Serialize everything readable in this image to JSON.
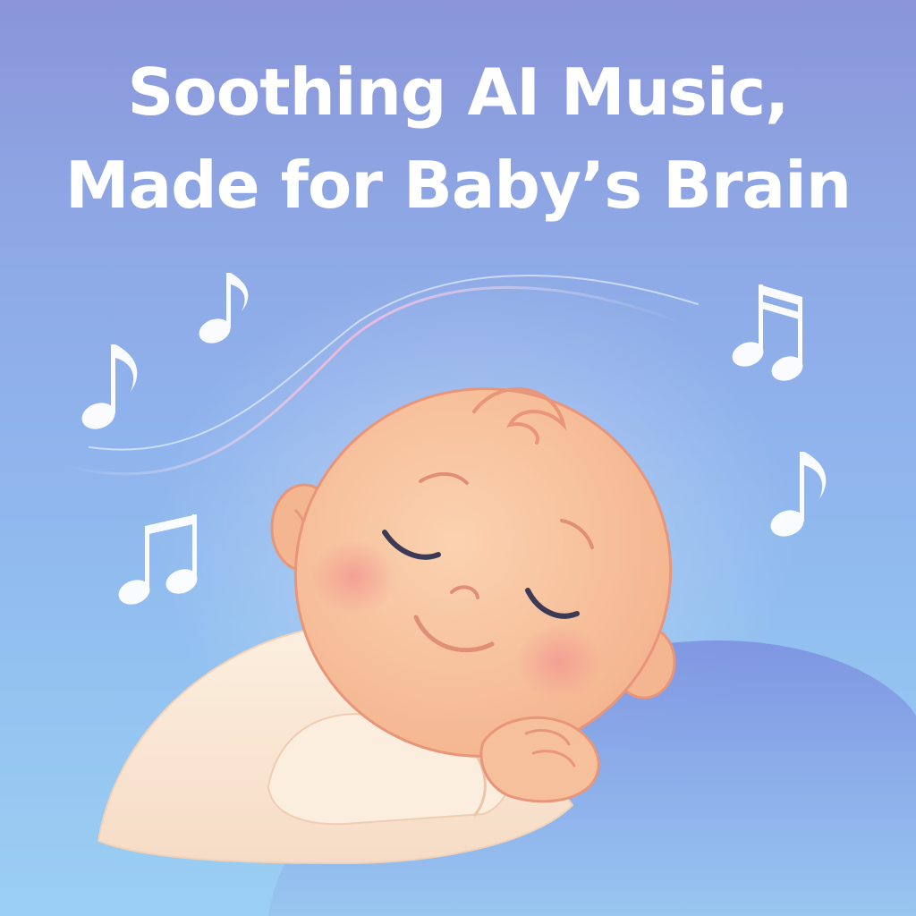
{
  "headline": {
    "line1": "Soothing AI Music,",
    "line2": "Made for Baby’s Brain"
  },
  "colors": {
    "background_top": "#8a95d9",
    "background_bottom": "#9bcff3",
    "headline_text": "#ffffff",
    "skin": "#f7c4a0",
    "skin_outline": "#e9957a",
    "cheeks": "#f3a49a",
    "onesie": "#fbeede",
    "note": "#ffffff",
    "pillow": "#7c8fe0"
  },
  "icons": [
    "music-note-icon",
    "beamed-notes-icon"
  ]
}
